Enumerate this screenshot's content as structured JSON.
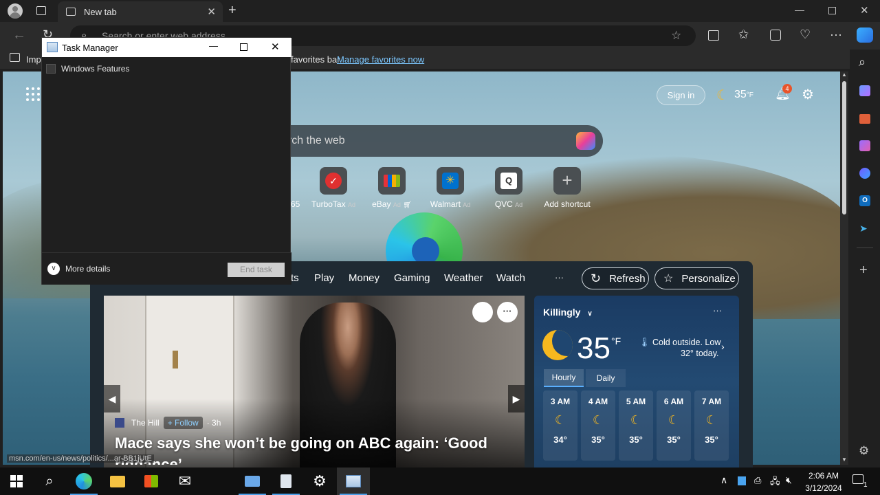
{
  "browser": {
    "tab_title": "New tab",
    "address_placeholder": "Search or enter web address",
    "favorites_import_label": "Imp",
    "favorites_message": "favorites bar.",
    "favorites_link": "Manage favorites now",
    "status_url": "msn.com/en-us/news/politics/...ar-BB1jUtE"
  },
  "msn": {
    "sign_in": "Sign in",
    "weather_short": "35",
    "weather_unit_short": "°F",
    "notifications_count": "4",
    "search_placeholder": "arch the web",
    "shortcuts": [
      {
        "label": "65"
      },
      {
        "label": "TurboTax",
        "ad": "Ad"
      },
      {
        "label": "eBay",
        "ad": "Ad"
      },
      {
        "label": "Walmart",
        "ad": "Ad"
      },
      {
        "label": "QVC",
        "ad": "Ad"
      },
      {
        "label": "Add shortcut"
      }
    ],
    "nav": [
      "ts",
      "Play",
      "Money",
      "Gaming",
      "Weather",
      "Watch"
    ],
    "more": "···",
    "refresh": "Refresh",
    "personalize": "Personalize"
  },
  "article": {
    "source": "The Hill",
    "follow": "Follow",
    "age": "· 3h",
    "headline": "Mace says she won’t be going on ABC again: ‘Good",
    "headline_cont": "riddance’"
  },
  "weather": {
    "location": "Killingly",
    "temp": "35",
    "unit": "°F",
    "summary_line1": "Cold outside. Low",
    "summary_line2": "32° today.",
    "tab_hourly": "Hourly",
    "tab_daily": "Daily",
    "hours": [
      {
        "time": "3 AM",
        "temp": "34°"
      },
      {
        "time": "4 AM",
        "temp": "35°"
      },
      {
        "time": "5 AM",
        "temp": "35°"
      },
      {
        "time": "6 AM",
        "temp": "35°"
      },
      {
        "time": "7 AM",
        "temp": "35°"
      }
    ]
  },
  "task_manager": {
    "title": "Task Manager",
    "items": [
      "Windows Features"
    ],
    "more_details": "More details",
    "end_task": "End task"
  },
  "taskbar": {
    "time": "2:06 AM",
    "date": "3/12/2024",
    "notification_count": "1"
  },
  "colors": {
    "accent": "#4a9fe8",
    "link": "#7cc7ff",
    "badge": "#e8542a"
  }
}
